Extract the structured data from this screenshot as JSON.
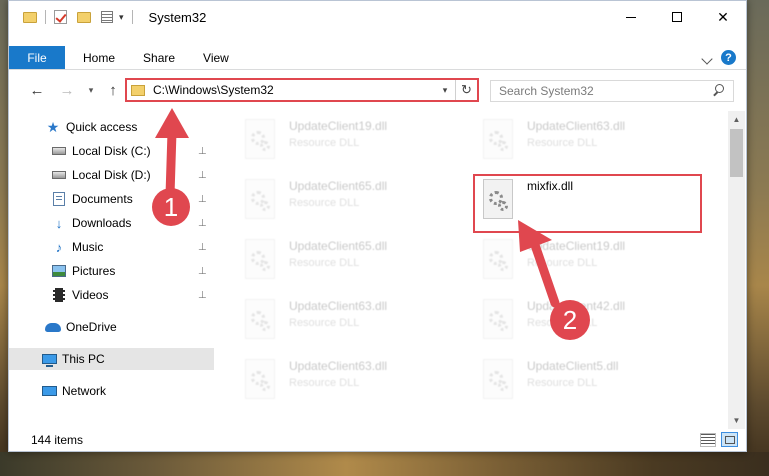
{
  "window": {
    "title": "System32",
    "controls": {
      "minimize": "—",
      "maximize": "☐",
      "close": "✕"
    }
  },
  "ribbon": {
    "tabs": [
      "File",
      "Home",
      "Share",
      "View"
    ],
    "help": "?"
  },
  "navigation": {
    "back": "←",
    "forward": "→",
    "recent": "▾",
    "up": "↑",
    "address": "C:\\Windows\\System32",
    "address_dropdown": "▾",
    "refresh": "↻"
  },
  "search": {
    "placeholder": "Search System32"
  },
  "sidebar": {
    "items": [
      {
        "label": "Quick access",
        "icon": "star-icon",
        "pinned": false
      },
      {
        "label": "Local Disk (C:)",
        "icon": "drive-icon",
        "pinned": true
      },
      {
        "label": "Local Disk (D:)",
        "icon": "drive-icon",
        "pinned": true
      },
      {
        "label": "Documents",
        "icon": "documents-icon",
        "pinned": true
      },
      {
        "label": "Downloads",
        "icon": "download-icon",
        "pinned": true
      },
      {
        "label": "Music",
        "icon": "music-icon",
        "pinned": true
      },
      {
        "label": "Pictures",
        "icon": "pictures-icon",
        "pinned": true
      },
      {
        "label": "Videos",
        "icon": "videos-icon",
        "pinned": true
      },
      {
        "label": "OneDrive",
        "icon": "onedrive-icon",
        "pinned": false
      },
      {
        "label": "This PC",
        "icon": "computer-icon",
        "pinned": false,
        "selected": true
      },
      {
        "label": "Network",
        "icon": "network-icon",
        "pinned": false
      }
    ],
    "pin_glyph": "📌"
  },
  "files": [
    {
      "name": "UpdateClient19.dll",
      "type": "Resource DLL",
      "faded": true
    },
    {
      "name": "UpdateClient63.dll",
      "type": "Resource DLL",
      "faded": true
    },
    {
      "name": "UpdateClient65.dll",
      "type": "Resource DLL",
      "faded": true
    },
    {
      "name": "mixfix.dll",
      "type": "",
      "faded": false,
      "highlighted": true
    },
    {
      "name": "UpdateClient65.dll",
      "type": "Resource DLL",
      "faded": true
    },
    {
      "name": "UpdateClient19.dll",
      "type": "Resource DLL",
      "faded": true
    },
    {
      "name": "UpdateClient63.dll",
      "type": "Resource DLL",
      "faded": true
    },
    {
      "name": "UpdateClient42.dll",
      "type": "Resource DLL",
      "faded": true
    },
    {
      "name": "UpdateClient63.dll",
      "type": "Resource DLL",
      "faded": true
    },
    {
      "name": "UpdateClient5.dll",
      "type": "Resource DLL",
      "faded": true
    }
  ],
  "status": {
    "item_count": "144 items"
  },
  "annotations": {
    "badges": [
      "1",
      "2"
    ],
    "color": "#e0474f"
  },
  "colors": {
    "accent": "#1979ca",
    "highlight": "#e0474f",
    "selected_nav": "#e5e5e5"
  }
}
